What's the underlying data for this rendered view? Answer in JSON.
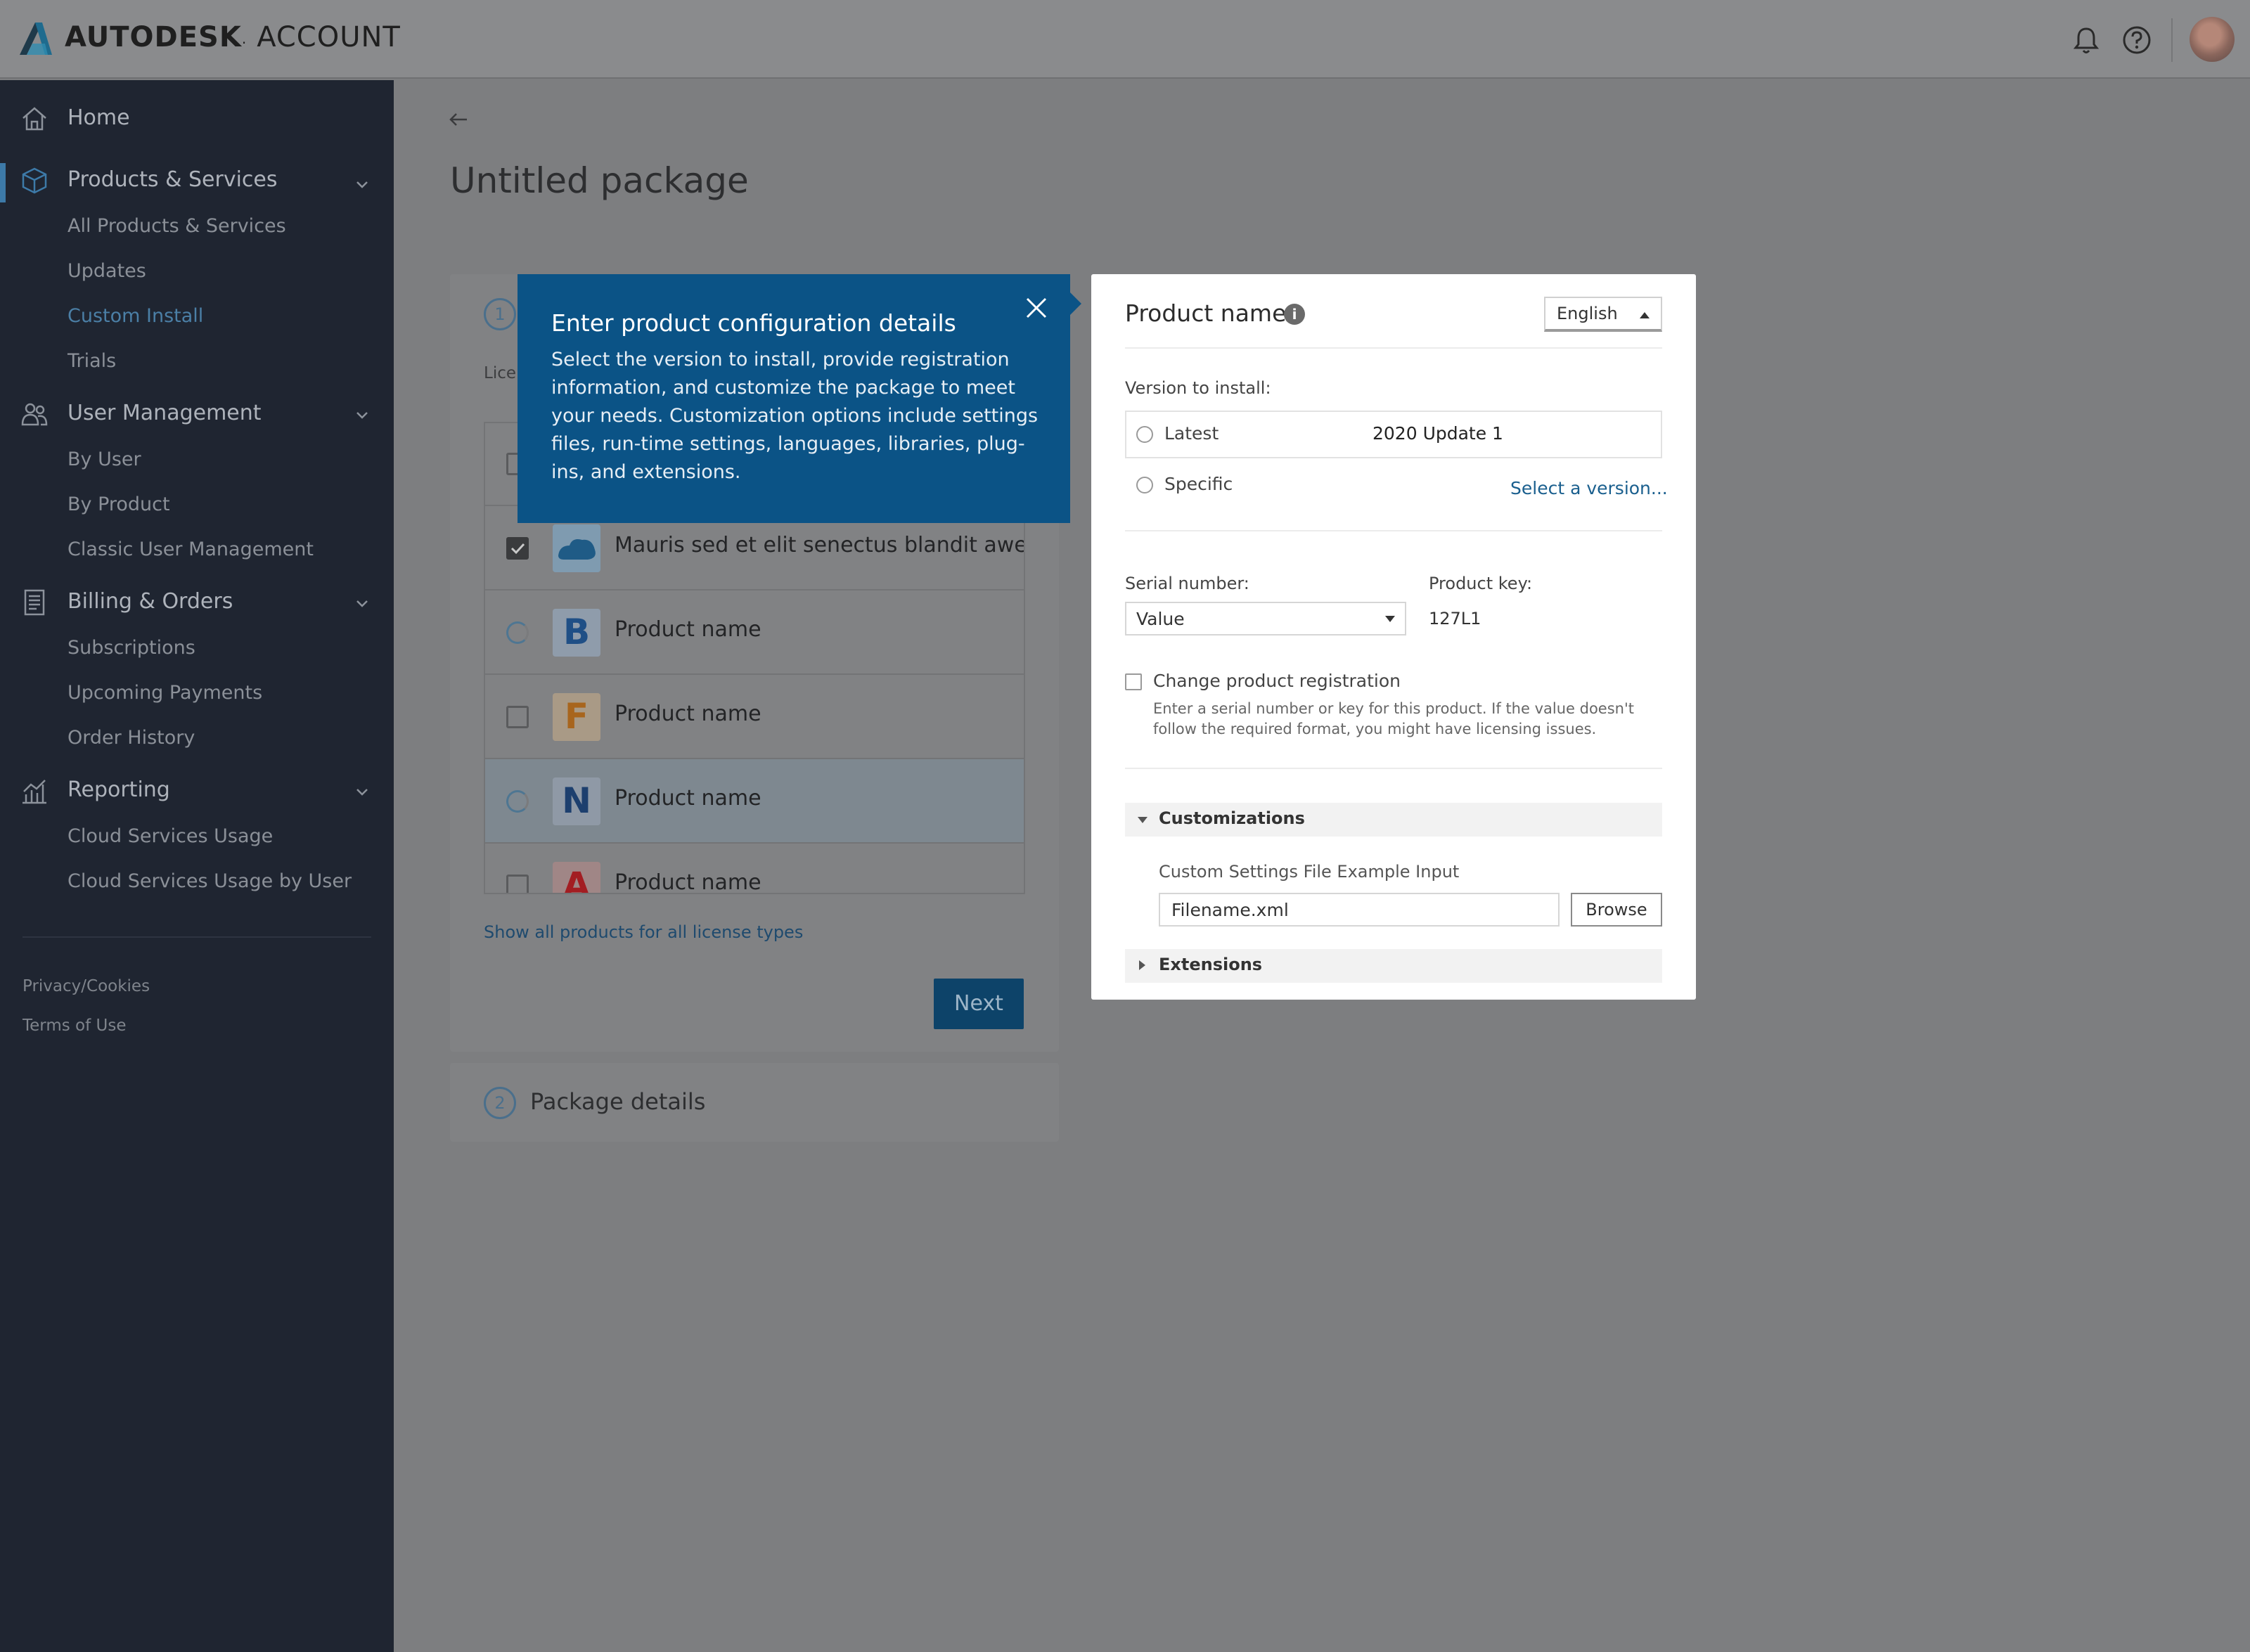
{
  "header": {
    "brand": "AUTODESK",
    "account": "ACCOUNT",
    "colors": {
      "brand_mark": "#1f6b8e"
    }
  },
  "sidebar": {
    "sections": [
      {
        "label": "Home",
        "icon": "home-icon"
      },
      {
        "label": "Products & Services",
        "icon": "box-icon",
        "items": [
          "All Products & Services",
          "Updates",
          "Custom Install",
          "Trials"
        ]
      },
      {
        "label": "User Management",
        "icon": "users-icon",
        "items": [
          "By User",
          "By Product",
          "Classic User Management"
        ]
      },
      {
        "label": "Billing & Orders",
        "icon": "receipt-icon",
        "items": [
          "Subscriptions",
          "Upcoming Payments",
          "Order History"
        ]
      },
      {
        "label": "Reporting",
        "icon": "chart-icon",
        "items": [
          "Cloud Services Usage",
          "Cloud Services Usage by User"
        ]
      }
    ],
    "active_item": "Custom Install",
    "footer": [
      "Privacy/Cookies",
      "Terms of Use"
    ]
  },
  "page": {
    "title": "Untitled package",
    "step1": {
      "number": "1",
      "license_label": "Licen",
      "products": [
        {
          "name": "Mauris sed et elit senectus blandit awe...",
          "control": "checkbox",
          "checked": true,
          "icon": "cloud-product-icon"
        },
        {
          "name": "Product name",
          "control": "radio",
          "icon_letter": "B"
        },
        {
          "name": "Product name",
          "control": "checkbox",
          "checked": false,
          "icon_letter": "F"
        },
        {
          "name": "Product name",
          "control": "radio",
          "icon_letter": "N",
          "highlighted": true
        },
        {
          "name": "Product name",
          "control": "checkbox",
          "checked": false,
          "icon_letter": "A"
        }
      ],
      "show_all_link": "Show all products for all license types",
      "next_button": "Next"
    },
    "step2": {
      "number": "2",
      "label": "Package details"
    }
  },
  "tooltip": {
    "title": "Enter product configuration details",
    "body": "Select the version to install, provide registration information, and customize the package to meet your needs. Customization options include settings files, run-time settings, languages, libraries, plug-ins, and extensions."
  },
  "config_panel": {
    "title": "Product name",
    "language": "English",
    "version_label": "Version to install:",
    "latest_label": "Latest",
    "latest_version": "2020 Update 1",
    "specific_label": "Specific",
    "select_version_link": "Select a version...",
    "serial_label": "Serial number:",
    "serial_value": "Value",
    "product_key_label": "Product key:",
    "product_key_value": "127L1",
    "change_registration_label": "Change product registration",
    "change_registration_help": "Enter a serial number or key for this product. If the value doesn't follow the required format, you might have licensing issues.",
    "customizations_label": "Customizations",
    "custom_settings_label": "Custom Settings File Example Input",
    "custom_settings_value": "Filename.xml",
    "browse_button": "Browse",
    "extensions_label": "Extensions"
  }
}
